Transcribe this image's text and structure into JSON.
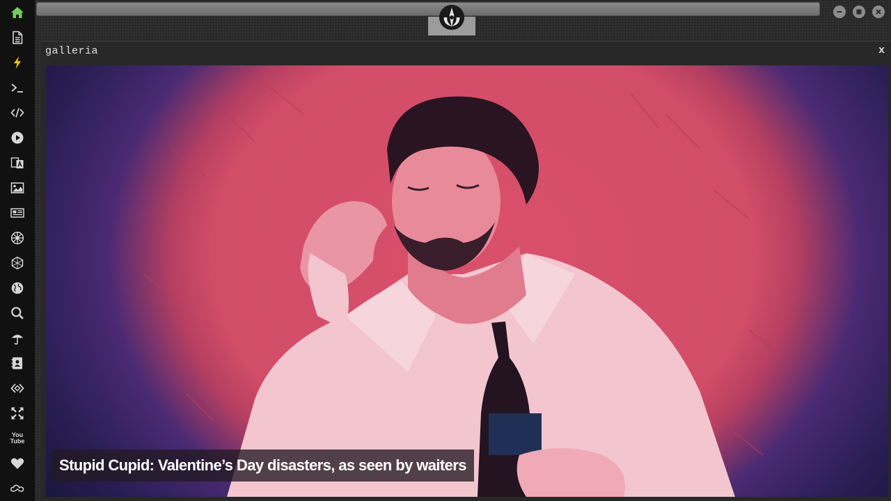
{
  "sidebar": {
    "items": [
      {
        "name": "home-icon",
        "color": "#6fce5a"
      },
      {
        "name": "document-icon"
      },
      {
        "name": "lightning-icon",
        "color": "#f1c40f"
      },
      {
        "name": "terminal-icon"
      },
      {
        "name": "code-icon"
      },
      {
        "name": "play-icon"
      },
      {
        "name": "translate-icon"
      },
      {
        "name": "image-icon"
      },
      {
        "name": "newspaper-icon"
      },
      {
        "name": "empire-icon"
      },
      {
        "name": "hexagon-network-icon"
      },
      {
        "name": "globe-icon"
      },
      {
        "name": "search-icon"
      },
      {
        "name": "umbrella-icon"
      },
      {
        "name": "contacts-icon"
      },
      {
        "name": "diamond-code-icon"
      },
      {
        "name": "expand-arrows-icon"
      },
      {
        "name": "youtube-icon",
        "text": "You\nTube"
      },
      {
        "name": "heart-icon"
      },
      {
        "name": "infinity-cloud-icon"
      }
    ]
  },
  "window": {
    "title": "galleria",
    "close_label": "x"
  },
  "gallery": {
    "caption": "Stupid Cupid: Valentine’s Day disasters, as seen by waiters"
  },
  "controls": [
    "minimize",
    "maximize",
    "close"
  ]
}
